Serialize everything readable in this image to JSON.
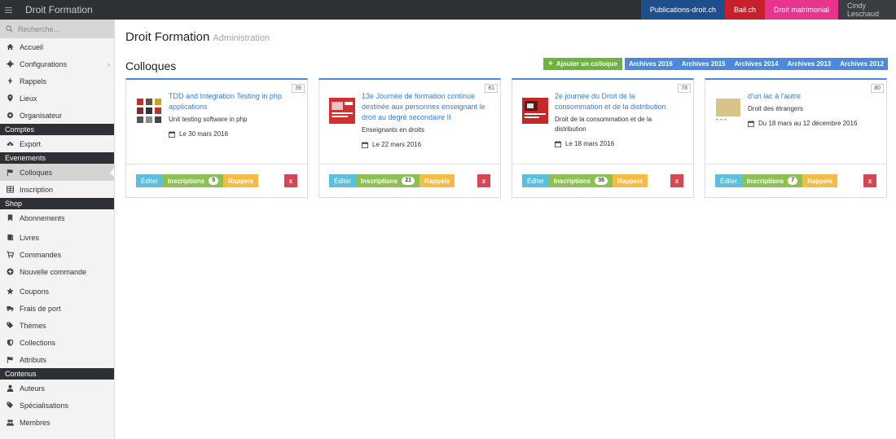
{
  "app": {
    "brand": "Droit Formation",
    "top_links": [
      {
        "label": "Publications-droit.ch"
      },
      {
        "label": "Bail.ch"
      },
      {
        "label": "Droit matrimonial"
      }
    ],
    "user": "Cindy Leschaud"
  },
  "sidebar": {
    "search_placeholder": "Recherche...",
    "items": [
      {
        "label": "Accueil",
        "icon": "home-icon"
      },
      {
        "label": "Configurations",
        "icon": "cog-icon"
      },
      {
        "label": "Rappels",
        "icon": "bolt-icon"
      },
      {
        "label": "Lieux",
        "icon": "map-marker-icon"
      },
      {
        "label": "Organisateur",
        "icon": "circle-icon"
      }
    ],
    "section_comptes": "Comptes",
    "comptes_items": [
      {
        "label": "Export",
        "icon": "cloud-download-icon"
      }
    ],
    "section_evenements": "Evenements",
    "evenements_items": [
      {
        "label": "Colloques",
        "icon": "flag-icon"
      },
      {
        "label": "Inscription",
        "icon": "table-icon"
      }
    ],
    "section_shop": "Shop",
    "shop_items": [
      {
        "label": "Abonnements",
        "icon": "bookmark-icon"
      },
      {
        "label": "Livres",
        "icon": "book-icon"
      },
      {
        "label": "Commandes",
        "icon": "cart-icon"
      },
      {
        "label": "Nouvelle commande",
        "icon": "plus-circle-icon"
      },
      {
        "label": "Coupons",
        "icon": "star-icon"
      },
      {
        "label": "Frais de port",
        "icon": "truck-icon"
      },
      {
        "label": "Thèmes",
        "icon": "tags-icon"
      },
      {
        "label": "Collections",
        "icon": "shield-icon"
      },
      {
        "label": "Attributs",
        "icon": "flag-icon"
      }
    ],
    "section_contenus": "Contenus",
    "contenus_items": [
      {
        "label": "Auteurs",
        "icon": "user-icon"
      },
      {
        "label": "Spécialisations",
        "icon": "tag-icon"
      },
      {
        "label": "Membres",
        "icon": "users-icon"
      }
    ]
  },
  "page": {
    "title": "Droit Formation",
    "subtitle": "Administration",
    "section_title": "Colloques",
    "add_button": "Ajouter un colloque",
    "archives": [
      "Archives 2016",
      "Archives 2015",
      "Archives 2014",
      "Archives 2013",
      "Archives 2012"
    ]
  },
  "colloques": [
    {
      "id": "39",
      "title": "TDD and Integration Testing in php applications",
      "subtitle": "Unit testing software in php",
      "date": "Le 30 mars 2016",
      "inscriptions": "5"
    },
    {
      "id": "81",
      "title": "13e Journée de formation continue destinée aux personnes enseignant le droit au degré secondaire II",
      "subtitle": "Enseignants en droits",
      "date": "Le 22 mars 2016",
      "inscriptions": "21"
    },
    {
      "id": "78",
      "title": "2e journée du Droit de la consommation et de la distribution",
      "subtitle": "Droit de la consommation et de la distribution",
      "date": "Le 18 mars 2016",
      "inscriptions": "36"
    },
    {
      "id": "80",
      "title": "d'un lac à l'autre",
      "subtitle": "Droit des étrangers",
      "date": "Du 18 mars au 12 décembre 2016",
      "inscriptions": "7"
    }
  ],
  "card_actions": {
    "edit": "Éditer",
    "inscriptions": "Inscriptions",
    "rappels": "Rappels",
    "delete": "x"
  },
  "colors": {
    "topbar": "#2d3035",
    "accent_blue": "#4a89dc",
    "green": "#8cc152",
    "yellow": "#f6bb42",
    "red": "#da4453",
    "cyan": "#5bc0de"
  }
}
